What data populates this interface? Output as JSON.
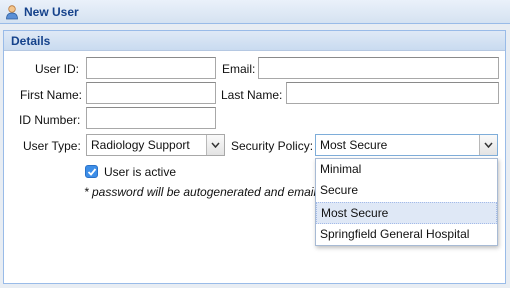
{
  "window": {
    "title": "New User",
    "icon": "user-icon"
  },
  "section": {
    "legend": "Details"
  },
  "form": {
    "user_id": {
      "label": "User ID:",
      "value": ""
    },
    "email": {
      "label": "Email:",
      "value": ""
    },
    "first_name": {
      "label": "First Name:",
      "value": ""
    },
    "last_name": {
      "label": "Last Name:",
      "value": ""
    },
    "id_number": {
      "label": "ID Number:",
      "value": ""
    },
    "user_type": {
      "label": "User Type:",
      "value": "Radiology Support"
    },
    "security_policy": {
      "label": "Security Policy:",
      "value": "Most Secure",
      "options": [
        "Minimal",
        "Secure",
        "Most Secure",
        "Springfield General Hospital"
      ],
      "selected_index": 2,
      "expanded": true
    },
    "active": {
      "label": "User is active",
      "checked": true
    },
    "note": "* password will be autogenerated and emailed"
  },
  "colors": {
    "header_text": "#15428b",
    "border": "#99bbe8",
    "checkbox": "#3d8ee8",
    "selected_option_bg": "#dfe8f6"
  }
}
